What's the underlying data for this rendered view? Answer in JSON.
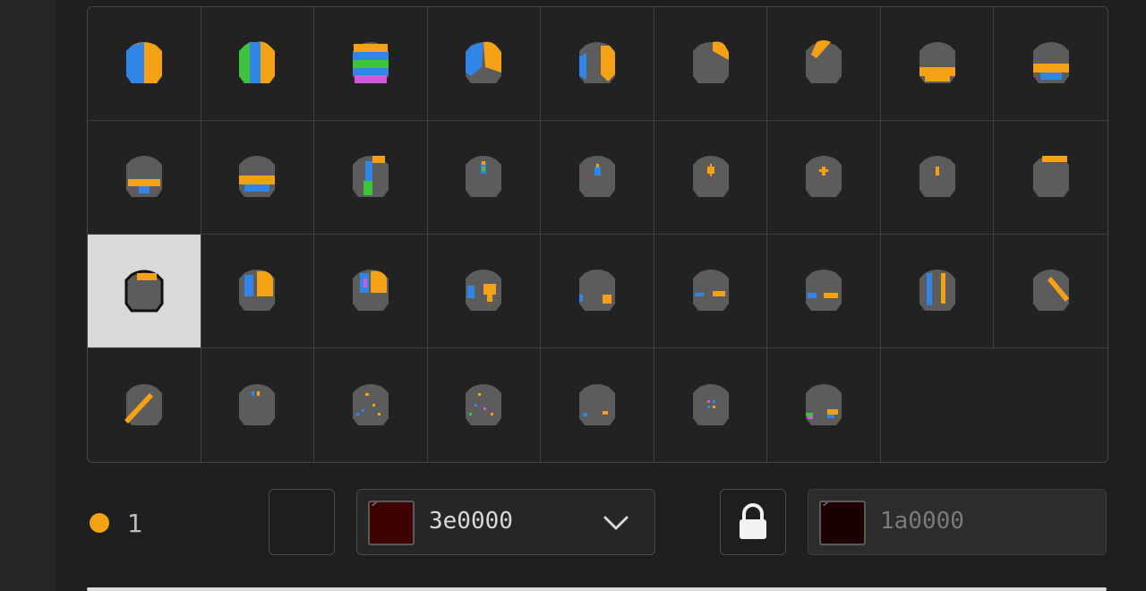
{
  "palette": {
    "orange": "#f4a116",
    "blue": "#2f86e6",
    "green": "#3ec43a",
    "pink": "#d05ad8",
    "helmet_gray": "#5c5c5c",
    "outline": "#111111"
  },
  "helmet_grid": {
    "selected_index": 18,
    "items": [
      "helmet-pattern-01",
      "helmet-pattern-02",
      "helmet-pattern-03",
      "helmet-pattern-04",
      "helmet-pattern-05",
      "helmet-pattern-06",
      "helmet-pattern-07",
      "helmet-pattern-08",
      "helmet-pattern-09",
      "helmet-pattern-10",
      "helmet-pattern-11",
      "helmet-pattern-12",
      "helmet-pattern-13",
      "helmet-pattern-14",
      "helmet-pattern-15",
      "helmet-pattern-16",
      "helmet-pattern-17",
      "helmet-pattern-18",
      "helmet-pattern-19",
      "helmet-pattern-20",
      "helmet-pattern-21",
      "helmet-pattern-22",
      "helmet-pattern-23",
      "helmet-pattern-24",
      "helmet-pattern-25",
      "helmet-pattern-26",
      "helmet-pattern-27",
      "helmet-pattern-28",
      "helmet-pattern-29",
      "helmet-pattern-30",
      "helmet-pattern-31",
      "helmet-pattern-32",
      "helmet-pattern-33",
      "helmet-pattern-34"
    ]
  },
  "layer": {
    "dot_color": "#f4a116",
    "count": "1"
  },
  "primary_color": {
    "hex": "3e0000",
    "swatch_color": "#3e0000",
    "icon": "chevron-down-icon"
  },
  "lock": {
    "icon": "lock-icon"
  },
  "secondary_color": {
    "hex": "1a0000",
    "swatch_color": "#1a0000"
  }
}
